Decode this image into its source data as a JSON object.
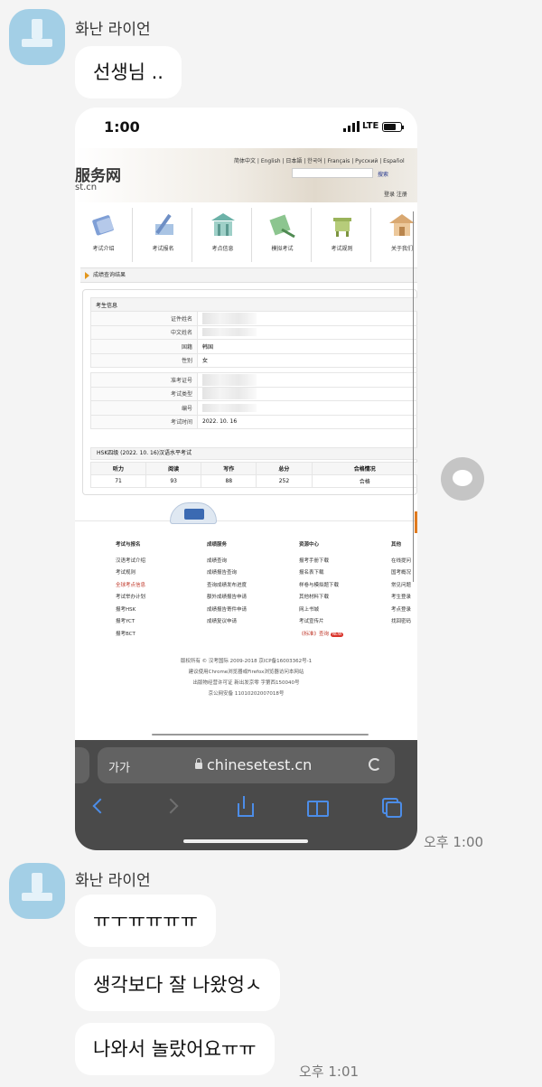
{
  "colors": {
    "background": "#f4f4f4",
    "avatar": "#a3cfe6",
    "bubble": "#ffffff",
    "browser_accent": "#4c8de8"
  },
  "chat": {
    "group1": {
      "sender": "화난 라이언",
      "messages": [
        "선생님 .."
      ],
      "time": "오후 1:00"
    },
    "group2": {
      "sender": "화난 라이언",
      "messages": [
        "ㅠㅜㅠㅠㅠㅠ",
        "생각보다 잘 나왔엉ㅅ",
        "나와서 놀랐어요ㅠㅠ"
      ],
      "time": "오후 1:01"
    }
  },
  "screenshot": {
    "status": {
      "time": "1:00",
      "network": "LTE"
    },
    "site": {
      "title": "服务网",
      "domain": "st.cn",
      "languages": "简体中文 | English | 日本語 | 한국어 | Français | Русский | Español",
      "search_button": "搜索",
      "login": "登录  注册",
      "nav": [
        "考试介绍",
        "考试报名",
        "考点信息",
        "模拟考试",
        "考试规则",
        "关于我们"
      ],
      "breadcrumb": "成绩查询结果",
      "info_header": "考生信息",
      "info_rows": [
        {
          "label": "证件姓名",
          "value": ""
        },
        {
          "label": "中文姓名",
          "value": ""
        },
        {
          "label": "国籍",
          "value": "韩国"
        },
        {
          "label": "性别",
          "value": "女"
        },
        {
          "label": "准考证号",
          "value": ""
        },
        {
          "label": "考试类型",
          "value": ""
        },
        {
          "label": "编号",
          "value": ""
        },
        {
          "label": "考试时间",
          "value": "2022. 10. 16"
        }
      ],
      "score_title": "HSK四级 (2022. 10. 16)汉语水平考试",
      "score_headers": [
        "听力",
        "阅读",
        "写作",
        "总分",
        "合格情况"
      ],
      "score_values": [
        "71",
        "93",
        "88",
        "252",
        "合格"
      ],
      "footer_cols": [
        {
          "head": "考试与报名",
          "items": [
            "汉语考试介绍",
            "考试规则",
            "全球考点信息",
            "考试举办计划",
            "报考HSK",
            "报考YCT",
            "报考BCT"
          ]
        },
        {
          "head": "成绩服务",
          "items": [
            "成绩查询",
            "成绩报告查询",
            "查询成绩发布进度",
            "额外成绩报告申请",
            "成绩报告寄件申请",
            "成绩复议申请"
          ]
        },
        {
          "head": "资源中心",
          "items": [
            "报考手册下载",
            "报名表下载",
            "样卷与模拟题下载",
            "其他材料下载",
            "网上书城",
            "考试宣传片",
            "《标准》查询"
          ]
        },
        {
          "head": "其他",
          "items": [
            "在线提问",
            "国考概况",
            "常见问题",
            "考生登录",
            "考点登录",
            "找回密码"
          ]
        }
      ],
      "new_badge": "NEW",
      "copyright": [
        "版权所有 © 汉考国际 2009-2018  京ICP备16003362号-1",
        "建议使用Chrome浏览器或Firefox浏览器访问本网站",
        "出版物经营许可证 新出发京零 字第西150040号",
        "京公网安备 11010202007018号"
      ]
    },
    "browser": {
      "text_size": "가가",
      "url": "chinesetest.cn"
    }
  }
}
